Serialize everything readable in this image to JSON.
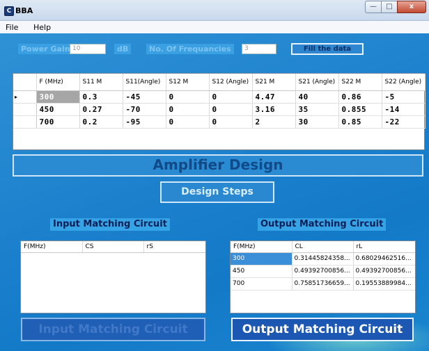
{
  "window": {
    "title": "BBA",
    "icon": "app-logo-icon"
  },
  "window_controls": {
    "minimize": "—",
    "maximize": "□",
    "close": "x"
  },
  "menu": [
    "File",
    "Help"
  ],
  "controls": {
    "power_gain_label": "Power Gain",
    "power_gain_value": "10",
    "db_label": "dB",
    "num_freq_label": "No. Of Frequancies",
    "num_freq_value": "3",
    "fill_button": "Fill the data"
  },
  "grid": {
    "columns": [
      "F (MHz)",
      "S11 M",
      "S11(Angle)",
      "S12 M",
      "S12 (Angle)",
      "S21 M",
      "S21 (Angle)",
      "S22 M",
      "S22 (Angle)"
    ],
    "row_indicator": "▸",
    "rows": [
      [
        "300",
        "0.3",
        "-45",
        "0",
        "0",
        "4.47",
        "40",
        "0.86",
        "-5"
      ],
      [
        "450",
        "0.27",
        "-70",
        "0",
        "0",
        "3.16",
        "35",
        "0.855",
        "-14"
      ],
      [
        "700",
        "0.2",
        "-95",
        "0",
        "0",
        "2",
        "30",
        "0.85",
        "-22"
      ]
    ]
  },
  "banner": "Amplifier Design",
  "design_steps_button": "Design Steps",
  "input_section": {
    "title": "Input Matching Circuit",
    "columns": [
      "F(MHz)",
      "CS",
      "rS"
    ],
    "rows": [],
    "button": "Input Matching Circuit"
  },
  "output_section": {
    "title": "Output Matching Circuit",
    "columns": [
      "F(MHz)",
      "CL",
      "rL"
    ],
    "rows": [
      [
        "300",
        "0.31445824358...",
        "0.68029462516..."
      ],
      [
        "450",
        "0.49392700856...",
        "0.49392700856..."
      ],
      [
        "700",
        "0.75851736659...",
        "0.19553889984..."
      ]
    ],
    "button": "Output Matching Circuit"
  }
}
